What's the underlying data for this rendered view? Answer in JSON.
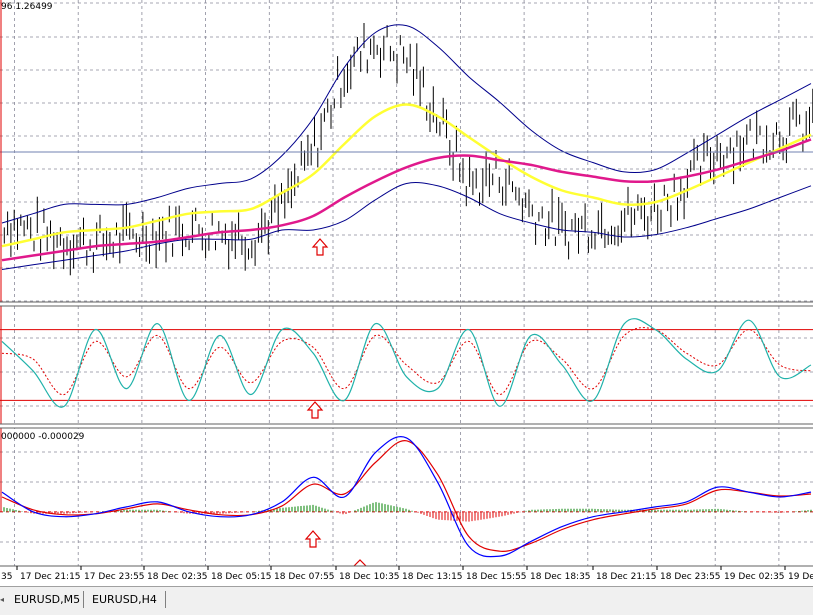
{
  "main_panel": {
    "price_label": "96 1.26499"
  },
  "macd_panel": {
    "label": "000000 -0.000029"
  },
  "x_axis_labels": [
    "35",
    "17 Dec 21:15",
    "17 Dec 23:55",
    "18 Dec 02:35",
    "18 Dec 05:15",
    "18 Dec 07:55",
    "18 Dec 10:35",
    "18 Dec 13:15",
    "18 Dec 15:55",
    "18 Dec 18:35",
    "18 Dec 21:15",
    "18 Dec 23:55",
    "19 Dec 02:35",
    "19 Dec"
  ],
  "tabs": [
    "EURUSD,M5",
    "EURUSD,H4"
  ],
  "colors": {
    "bars": "#000000",
    "bollinger": "#00008b",
    "ma_fast": "#ffff33",
    "ma_slow": "#e0198c",
    "stoch_main": "#20b2aa",
    "stoch_signal": "#e00000",
    "level_lines": "#e00000",
    "macd_main": "#0000ff",
    "macd_signal": "#e00000",
    "hist_pos": "#008000",
    "hist_neg": "#e00000",
    "arrow": "#e00000",
    "grid": "#8a8a9a"
  },
  "chart_data": [
    {
      "type": "line",
      "panel": "price",
      "x": [
        0,
        1,
        2,
        3,
        4,
        5,
        6,
        7,
        8,
        9,
        10,
        11,
        12,
        13,
        14,
        15,
        16,
        17,
        18,
        19,
        20,
        21,
        22,
        23,
        24,
        25,
        26
      ],
      "series": [
        {
          "values": [
            1.2596,
            1.259,
            1.2587,
            1.2585,
            1.2588,
            1.259,
            1.2592,
            1.259,
            1.2588,
            1.26,
            1.2625,
            1.266,
            1.2672,
            1.2665,
            1.264,
            1.261,
            1.2615,
            1.26,
            1.259,
            1.2594,
            1.2596,
            1.26,
            1.2612,
            1.2625,
            1.263,
            1.2633,
            1.2636
          ]
        },
        {
          "values": [
            1.2584,
            1.2587,
            1.259,
            1.2591,
            1.2592,
            1.2595,
            1.2598,
            1.2599,
            1.26,
            1.2607,
            1.2615,
            1.2628,
            1.264,
            1.2645,
            1.264,
            1.2631,
            1.2622,
            1.2614,
            1.2608,
            1.2605,
            1.2602,
            1.2603,
            1.2608,
            1.2614,
            1.262,
            1.2626,
            1.2632
          ]
        },
        {
          "values": [
            1.2578,
            1.258,
            1.2582,
            1.2584,
            1.2585,
            1.2586,
            1.2588,
            1.259,
            1.2591,
            1.2593,
            1.2597,
            1.2605,
            1.2612,
            1.2618,
            1.2622,
            1.2623,
            1.2621,
            1.2619,
            1.2616,
            1.2614,
            1.2612,
            1.2612,
            1.2614,
            1.2617,
            1.2621,
            1.2625,
            1.263
          ]
        }
      ],
      "ylim": [
        1.256,
        1.269
      ]
    },
    {
      "type": "line",
      "panel": "stochastic",
      "x": [
        0,
        1,
        2,
        3,
        4,
        5,
        6,
        7,
        8,
        9,
        10,
        11,
        12,
        13,
        14,
        15,
        16,
        17,
        18,
        19,
        20,
        21,
        22,
        23,
        24,
        25,
        26
      ],
      "series": [
        {
          "values": [
            70,
            45,
            15,
            80,
            30,
            85,
            20,
            75,
            25,
            80,
            60,
            20,
            85,
            40,
            30,
            80,
            15,
            75,
            50,
            20,
            85,
            80,
            55,
            45,
            88,
            40,
            50
          ]
        },
        {
          "values": [
            60,
            55,
            25,
            70,
            40,
            75,
            30,
            65,
            35,
            70,
            65,
            30,
            75,
            50,
            35,
            70,
            25,
            70,
            55,
            30,
            75,
            80,
            60,
            50,
            80,
            50,
            45
          ]
        }
      ],
      "levels": [
        80,
        20
      ],
      "ylim": [
        0,
        100
      ]
    },
    {
      "type": "line",
      "panel": "macd",
      "x": [
        0,
        1,
        2,
        3,
        4,
        5,
        6,
        7,
        8,
        9,
        10,
        11,
        12,
        13,
        14,
        15,
        16,
        17,
        18,
        19,
        20,
        21,
        22,
        23,
        24,
        25,
        26
      ],
      "series": [
        {
          "values": [
            0.0002,
            0.0,
            -5e-05,
            -2e-05,
            5e-05,
            0.0001,
            0.0,
            -5e-05,
            -3e-05,
            0.0001,
            0.00035,
            0.00015,
            0.0006,
            0.00075,
            0.0003,
            -0.00035,
            -0.00045,
            -0.0003,
            -0.00015,
            -5e-05,
            0.0,
            5e-05,
            0.0001,
            0.00025,
            0.0002,
            0.00015,
            0.0002
          ]
        },
        {
          "values": [
            0.00015,
            2e-05,
            -3e-05,
            -2e-05,
            3e-05,
            8e-05,
            2e-05,
            -3e-05,
            -3e-05,
            6e-05,
            0.00028,
            0.00018,
            0.0005,
            0.00072,
            0.00038,
            -0.00025,
            -0.0004,
            -0.00032,
            -0.00018,
            -8e-05,
            -2e-05,
            3e-05,
            8e-05,
            0.00022,
            0.0002,
            0.00016,
            0.00018
          ]
        }
      ],
      "histogram": [
        5e-05,
        -2e-05,
        -2e-05,
        0.0,
        2e-05,
        2e-05,
        -2e-05,
        -2e-05,
        0.0,
        4e-05,
        7e-05,
        -3e-05,
        0.0001,
        3e-05,
        -8e-05,
        -0.0001,
        -5e-05,
        2e-05,
        3e-05,
        3e-05,
        2e-05,
        2e-05,
        2e-05,
        3e-05,
        0.0,
        -1e-05,
        2e-05
      ],
      "ylim": [
        -0.00055,
        0.00085
      ]
    }
  ]
}
